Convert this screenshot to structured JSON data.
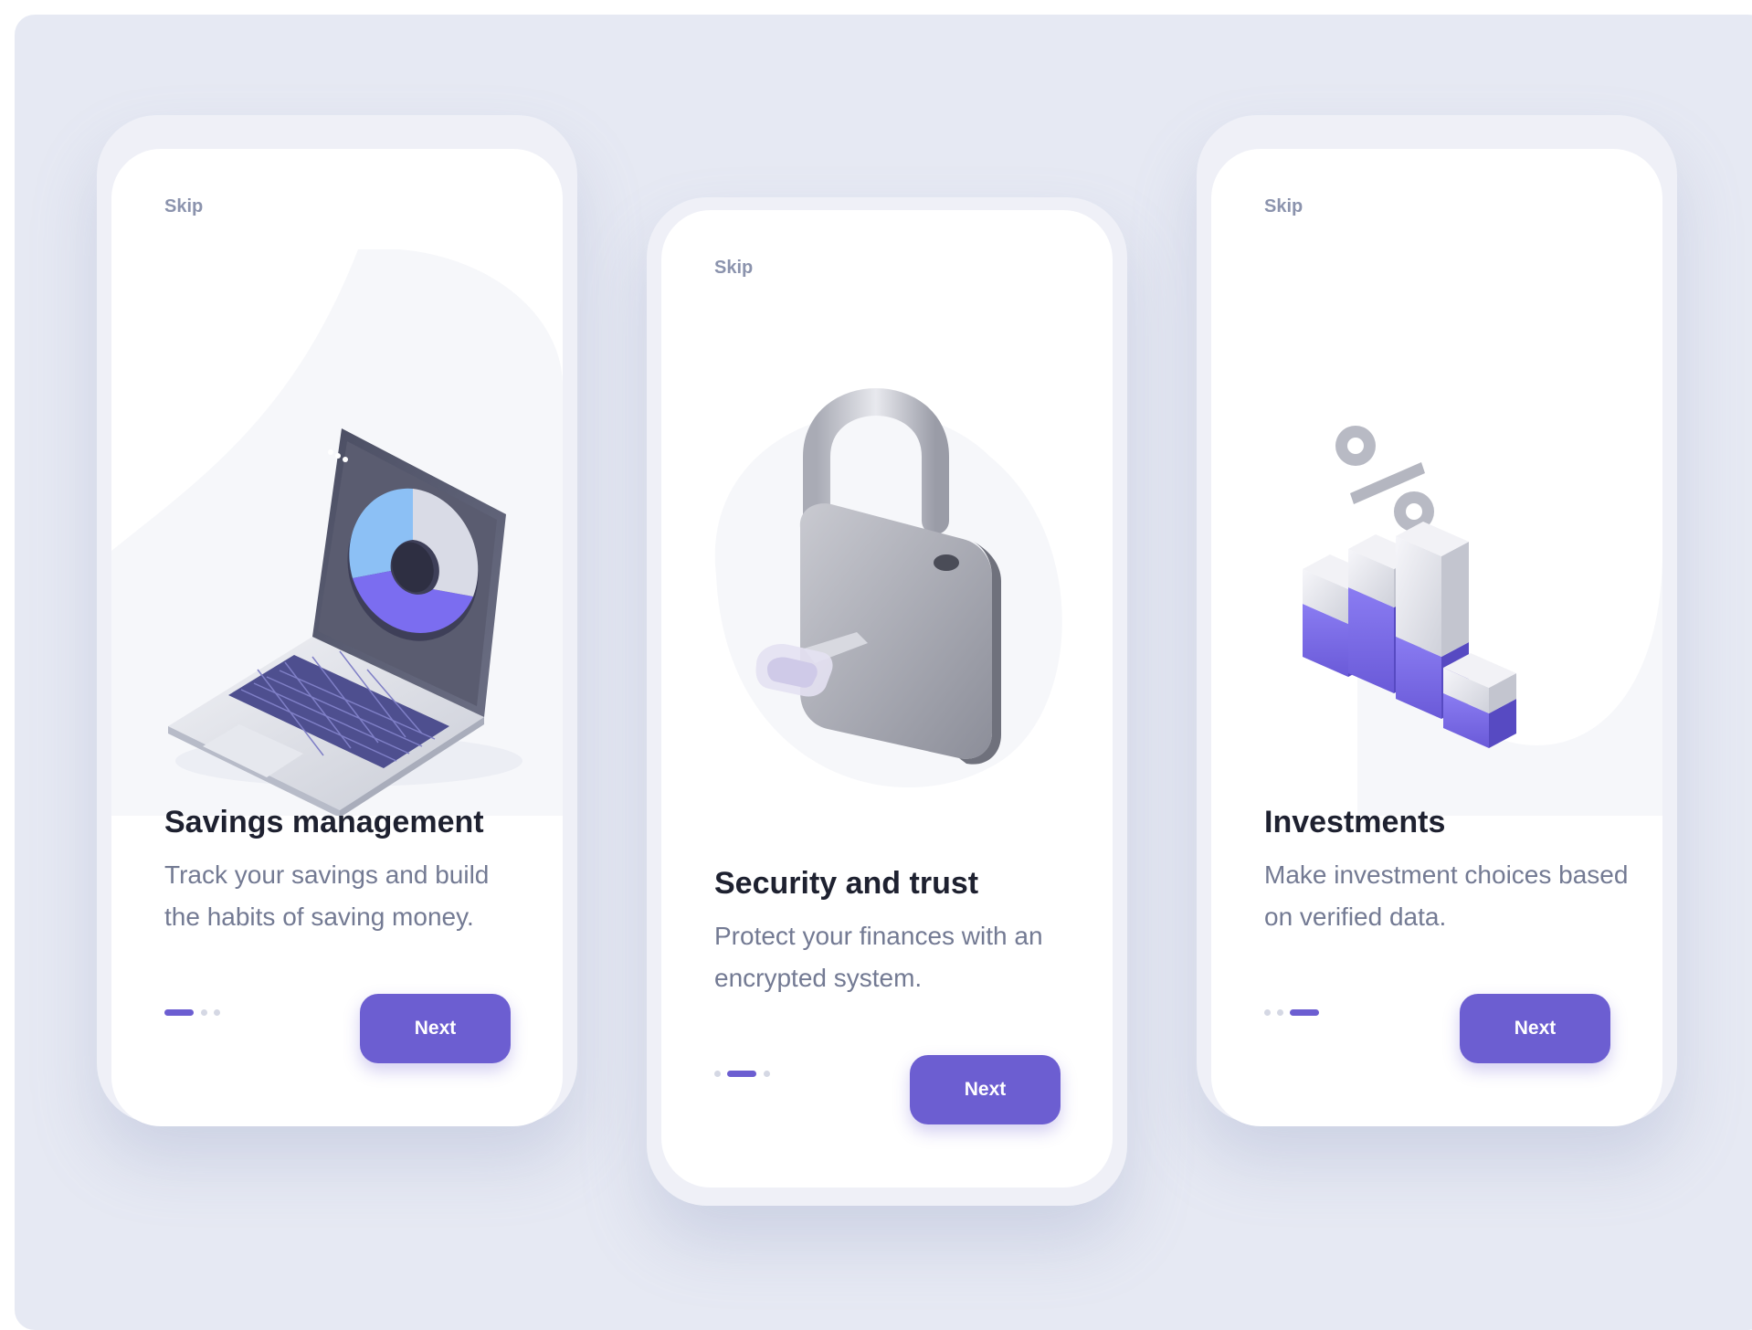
{
  "colors": {
    "accent": "#6c5ed1",
    "background": "#e6e9f3",
    "card": "#ffffff"
  },
  "screens": [
    {
      "skip": "Skip",
      "title": "Savings management",
      "description": "Track your savings and build the habits of saving money.",
      "next": "Next",
      "active_step": 1,
      "steps": 3,
      "illustration": "laptop-chart-icon"
    },
    {
      "skip": "Skip",
      "title": "Security and trust",
      "description": "Protect your finances with an encrypted system.",
      "next": "Next",
      "active_step": 2,
      "steps": 3,
      "illustration": "padlock-key-icon"
    },
    {
      "skip": "Skip",
      "title": "Investments",
      "description": "Make investment choices based on verified data.",
      "next": "Next",
      "active_step": 3,
      "steps": 3,
      "illustration": "bar-chart-percent-icon"
    }
  ]
}
